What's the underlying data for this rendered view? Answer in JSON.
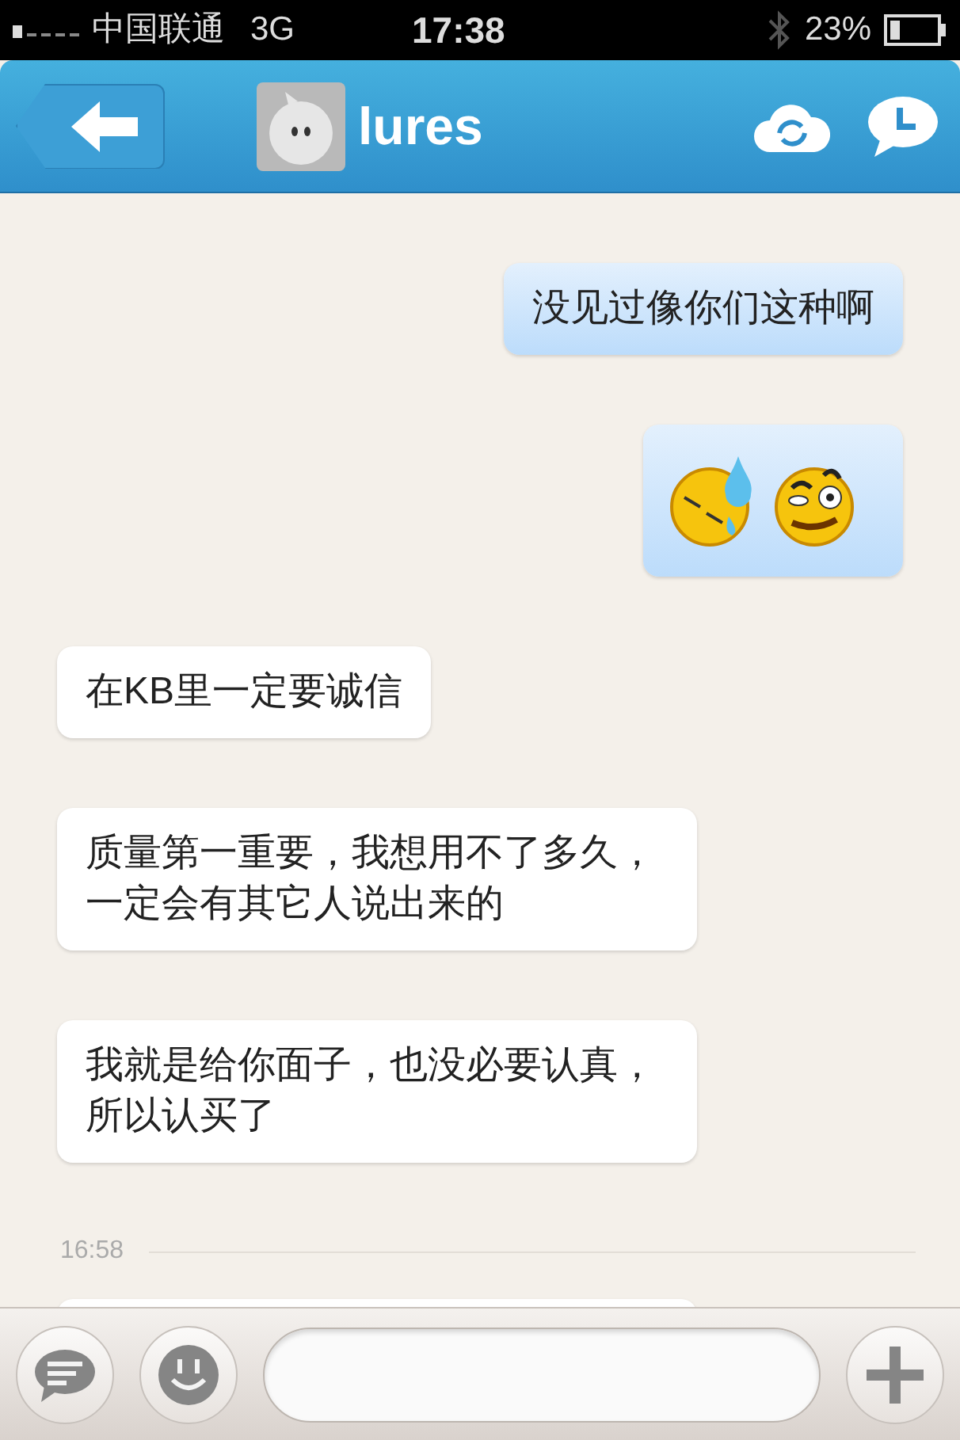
{
  "status_bar": {
    "carrier": "中国联通",
    "network": "3G",
    "time": "17:38",
    "battery": "23%"
  },
  "header": {
    "title": "lures"
  },
  "messages": [
    {
      "kind": "text",
      "outgoing": true,
      "text": "没见过像你们这种啊"
    },
    {
      "kind": "stickers",
      "outgoing": true,
      "stickers": [
        {
          "kind": "sweat"
        },
        {
          "kind": "grin"
        }
      ]
    },
    {
      "kind": "text",
      "outgoing": false,
      "text": "在KB里一定要诚信"
    },
    {
      "kind": "text",
      "outgoing": false,
      "text": "质量第一重要，我想用不了多久，一定会有其它人说出来的"
    },
    {
      "kind": "text",
      "outgoing": false,
      "text": "我就是给你面子，也没必要认真，所以认买了"
    },
    {
      "kind": "time",
      "text": "16:58"
    },
    {
      "kind": "partial",
      "outgoing": false
    }
  ]
}
